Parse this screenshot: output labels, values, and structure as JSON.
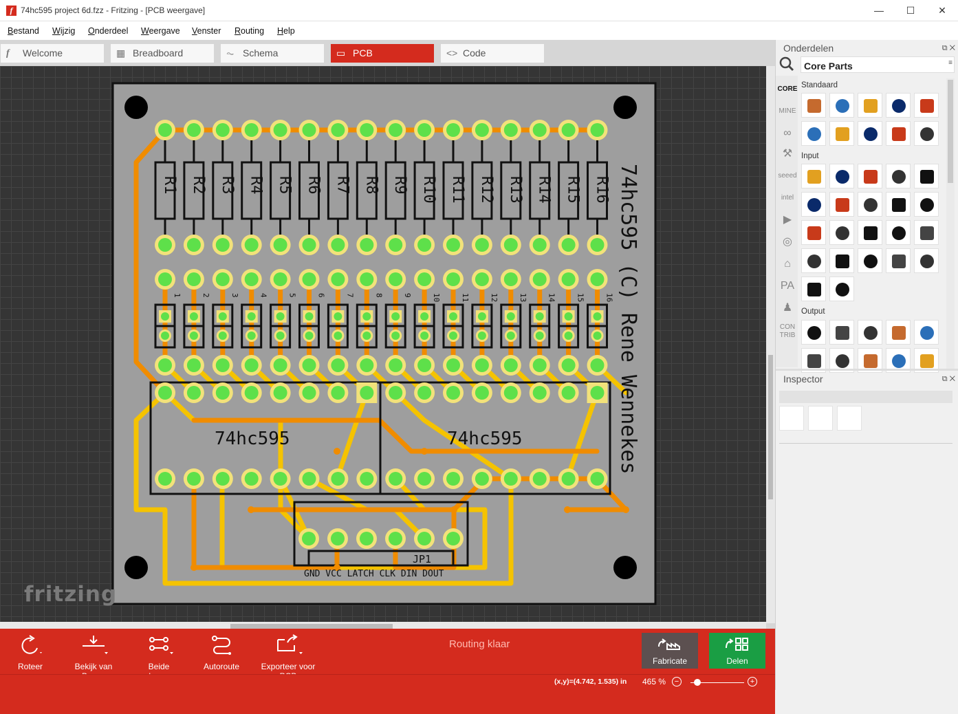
{
  "window": {
    "title": "74hc595 project 6d.fzz - Fritzing - [PCB weergave]",
    "minimize": "—",
    "maximize": "☐",
    "close": "✕"
  },
  "menu": [
    "Bestand",
    "Wijzig",
    "Onderdeel",
    "Weergave",
    "Venster",
    "Routing",
    "Help"
  ],
  "tabs": [
    {
      "label": "Welcome",
      "icon": "fritzing-f-icon"
    },
    {
      "label": "Breadboard",
      "icon": "breadboard-icon"
    },
    {
      "label": "Schema",
      "icon": "schematic-icon"
    },
    {
      "label": "PCB",
      "icon": "pcb-icon",
      "active": true
    },
    {
      "label": "Code",
      "icon": "code-icon"
    }
  ],
  "pcb": {
    "resistors": [
      "R1",
      "R2",
      "R3",
      "R4",
      "R5",
      "R6",
      "R7",
      "R8",
      "R9",
      "R10",
      "R11",
      "R12",
      "R13",
      "R14",
      "R15",
      "R16"
    ],
    "led_numbers": [
      "1",
      "2",
      "3",
      "4",
      "5",
      "6",
      "7",
      "8",
      "9",
      "10",
      "11",
      "12",
      "13",
      "14",
      "15",
      "16"
    ],
    "ic_label_1": "74hc595",
    "ic_label_2": "74hc595",
    "connector_label": "JP1",
    "pin_labels": "GND VCC LATCH CLK DIN DOUT",
    "side_text": "74hc595 (C) Rene Wennekes",
    "colors": {
      "board": "#9e9e9e",
      "trace_top": "#f08c00",
      "trace_bottom": "#f5c300",
      "pad": "#5ee04a",
      "ring": "#f2e27a"
    }
  },
  "watermark": "fritzing",
  "toolbar": {
    "rotate": "Roteer",
    "view_top": "Bekijk van Boven",
    "both_layers": "Beide lagen",
    "autoroute": "Autoroute",
    "export_pcb": "Exporteer voor PCB",
    "routing_status": "Routing klaar",
    "fabricate": "Fabricate",
    "share": "Delen"
  },
  "status": {
    "coords": "(x,y)=(4.742, 1.535) in",
    "zoom": "465 %",
    "zoom_minus": "−",
    "zoom_plus": "+"
  },
  "parts_panel": {
    "title": "Onderdelen",
    "bin_title": "Core Parts",
    "bins": [
      "CORE",
      "MINE",
      "∞",
      "⚒",
      "seeed",
      "intel",
      "▶",
      "◎",
      "⌂",
      "PA",
      "♟",
      "CON TRIB"
    ],
    "sections": [
      "Standaard",
      "Input",
      "Output"
    ]
  },
  "inspector": {
    "title": "Inspector"
  }
}
